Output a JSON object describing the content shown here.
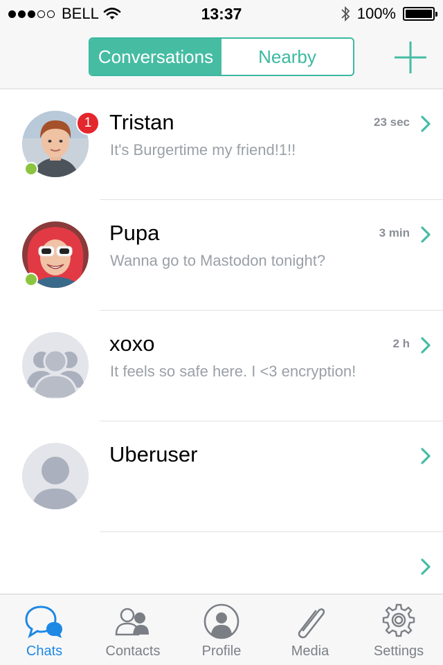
{
  "status_bar": {
    "carrier": "BELL",
    "time": "13:37",
    "battery": "100%"
  },
  "nav": {
    "segments": [
      "Conversations",
      "Nearby"
    ],
    "selected_segment": "Conversations",
    "add_icon": "plus-icon"
  },
  "chats": [
    {
      "name": "Tristan",
      "message": "It's Burgertime my friend!1!!",
      "time": "23 sec",
      "unread": "1",
      "online": true,
      "avatar": "photo"
    },
    {
      "name": "Pupa",
      "message": "Wanna go to Mastodon tonight?",
      "time": "3 min",
      "unread": "",
      "online": true,
      "avatar": "photo"
    },
    {
      "name": "xoxo",
      "message": "It feels so safe here. I <3 encryption!",
      "time": "2 h",
      "unread": "",
      "online": false,
      "avatar": "group-placeholder-icon"
    },
    {
      "name": "Uberuser",
      "message": "",
      "time": "",
      "unread": "",
      "online": false,
      "avatar": "user-placeholder-icon"
    },
    {
      "name": "",
      "message": "",
      "time": "",
      "unread": "",
      "online": false,
      "avatar": ""
    }
  ],
  "tabs": [
    {
      "label": "Chats",
      "icon": "chat-bubbles-icon",
      "active": true
    },
    {
      "label": "Contacts",
      "icon": "contacts-icon",
      "active": false
    },
    {
      "label": "Profile",
      "icon": "profile-icon",
      "active": false
    },
    {
      "label": "Media",
      "icon": "paperclip-icon",
      "active": false
    },
    {
      "label": "Settings",
      "icon": "gear-icon",
      "active": false
    }
  ],
  "colors": {
    "accent": "#46bca3",
    "active_tab": "#1e88e5",
    "badge": "#e4262d",
    "online": "#8bc53f",
    "secondary_text": "#9aa0a6"
  }
}
